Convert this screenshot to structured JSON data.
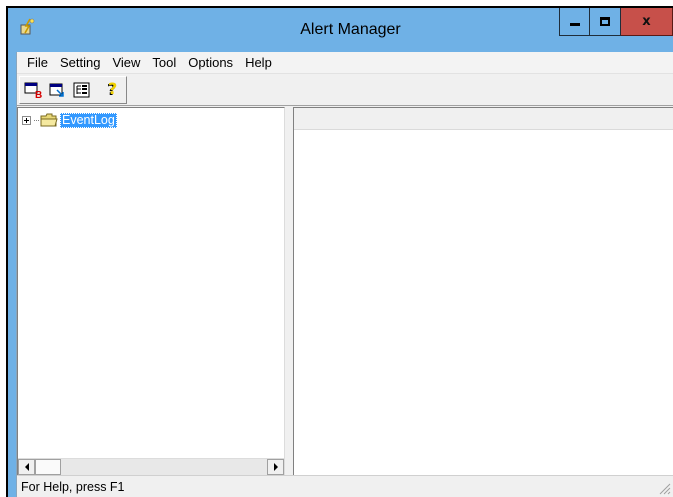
{
  "window": {
    "title": "Alert Manager",
    "close_glyph": "x"
  },
  "menubar": {
    "items": [
      "File",
      "Setting",
      "View",
      "Tool",
      "Options",
      "Help"
    ]
  },
  "toolbar": {
    "buttons": [
      {
        "icon": "new-alert-icon"
      },
      {
        "icon": "import-icon"
      },
      {
        "icon": "tree-view-icon"
      },
      {
        "icon": "help-question-icon"
      }
    ]
  },
  "tree": {
    "root": {
      "label": "EventLog",
      "icon": "folder-icon",
      "selected": true,
      "expanded": false
    }
  },
  "statusbar": {
    "text": "For Help, press F1"
  },
  "colors": {
    "titlebar": "#6fb1e6",
    "close_button": "#c7504a",
    "selection": "#3399ff"
  }
}
